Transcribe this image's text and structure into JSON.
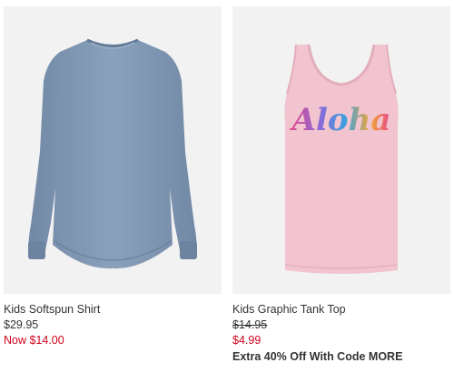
{
  "products": [
    {
      "name": "Kids Softspun Shirt",
      "price": "$29.95",
      "sale_price": "Now $14.00",
      "image_bg": "#f2f2f2",
      "garment_color": "#7f97b2"
    },
    {
      "name": "Kids Graphic Tank Top",
      "price": "$14.95",
      "sale_price": "$4.99",
      "promo": "Extra 40% Off With Code MORE",
      "image_bg": "#f2f2f2",
      "garment_color": "#f1c4cf",
      "graphic_text": "Aloha"
    }
  ],
  "colors": {
    "sale_red": "#d0021b",
    "text": "#333333"
  }
}
